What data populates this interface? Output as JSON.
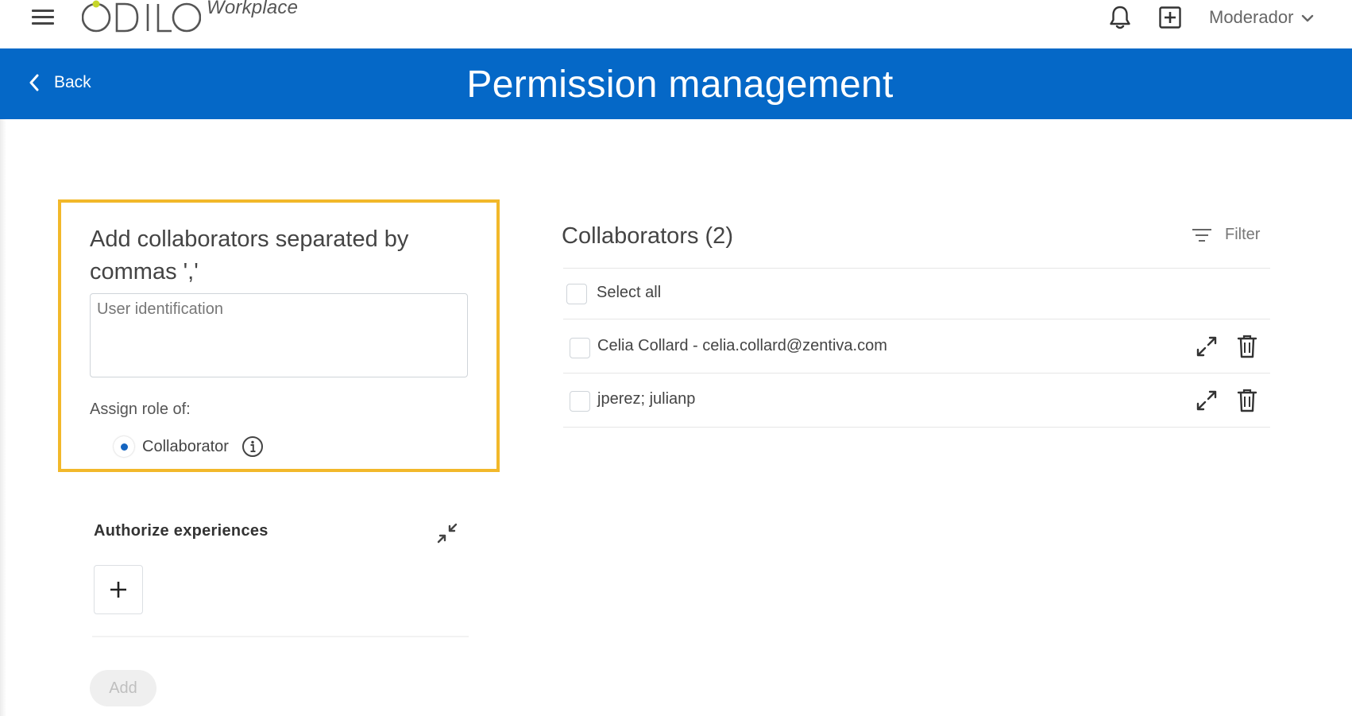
{
  "topbar": {
    "menu_icon": "hamburger-icon",
    "logo_text": "ODILO",
    "logo_sub": "Workplace",
    "notification_icon": "bell-icon",
    "create_icon": "add-square-icon",
    "user_role": "Moderador",
    "dropdown_icon": "chevron-down-icon"
  },
  "header": {
    "back_label": "Back",
    "title": "Permission management",
    "color": "#0568c7"
  },
  "add_panel": {
    "heading": "Add collaborators separated by commas ','",
    "input_value": "",
    "input_placeholder": "User identification",
    "role_label": "Assign role of:",
    "role_option": "Collaborator",
    "role_selected": true,
    "info_icon": "info-circle-icon",
    "highlight_color": "#f2b82a"
  },
  "authorize": {
    "title": "Authorize experiences",
    "collapse_icon": "collapse-icon",
    "add_icon": "plus-icon"
  },
  "actions": {
    "add_label": "Add"
  },
  "collaborators": {
    "title": "Collaborators (2)",
    "filter_label": "Filter",
    "filter_icon": "filter-icon",
    "select_all_label": "Select all",
    "items": [
      {
        "label": "Celia Collard - celia.collard@zentiva.com"
      },
      {
        "label": "jperez; julianp"
      }
    ]
  }
}
